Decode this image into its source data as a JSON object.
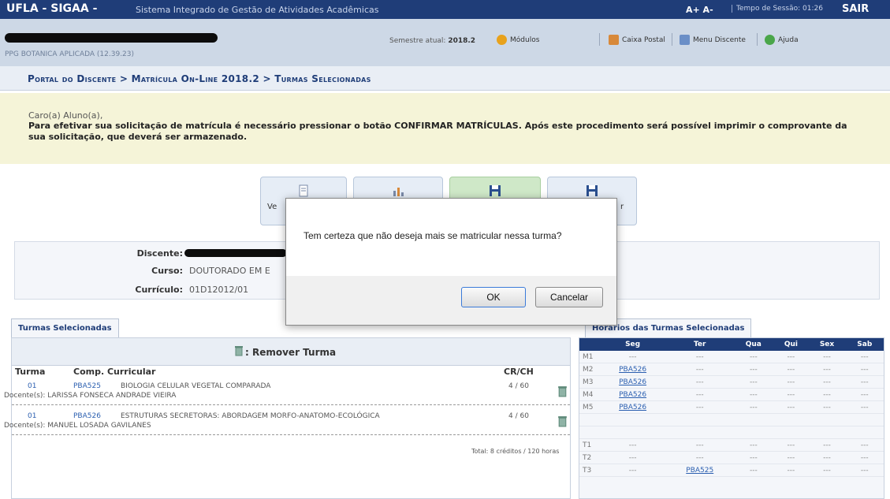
{
  "topbar": {
    "brand": "UFLA - SIGAA -",
    "system": "Sistema Integrado de Gestão de Atividades Acadêmicas",
    "font_controls": "A+ A-",
    "session": "Tempo de Sessão: 01:26",
    "exit": "SAIR"
  },
  "subbar": {
    "unit": "PPG BOTANICA APLICADA (12.39.23)",
    "semester_label": "Semestre atual:",
    "semester_value": "2018.2",
    "links": [
      "Módulos",
      "Caixa Postal",
      "Menu Discente",
      "Ajuda"
    ]
  },
  "page": {
    "title": "Portal do Discente > Matrícula On-Line 2018.2 > Turmas Selecionadas"
  },
  "message": {
    "greeting": "Caro(a) Aluno(a),",
    "text": "Para efetivar sua solicitação de matrícula é necessário pressionar o botão CONFIRMAR MATRÍCULAS. Após este procedimento será possível imprimir o comprovante da sua solicitação, que deverá ser armazenado."
  },
  "actions": {
    "btn1": "Ve",
    "btn4": "r"
  },
  "info": {
    "discente_label": "Discente:",
    "curso_label": "Curso:",
    "curso_value": "DOUTORADO EM E",
    "curriculo_label": "Currículo:",
    "curriculo_value": "01D12012/01"
  },
  "tabs": {
    "left": "Turmas Selecionadas",
    "right": "Horários das Turmas Selecionadas"
  },
  "turmas": {
    "remove_label": ": Remover Turma",
    "headers": {
      "turma": "Turma",
      "comp": "Comp. Curricular",
      "crch": "CR/CH"
    },
    "rows": [
      {
        "turma": "01",
        "code": "PBA525",
        "name": "BIOLOGIA CELULAR VEGETAL COMPARADA",
        "docente": "Docente(s): LARISSA FONSECA ANDRADE VIEIRA",
        "crch": "4 / 60"
      },
      {
        "turma": "01",
        "code": "PBA526",
        "name": "ESTRUTURAS SECRETORAS: ABORDAGEM MORFO-ANATOMO-ECOLÓGICA",
        "docente": "Docente(s): MANUEL LOSADA GAVILANES",
        "crch": "4 / 60"
      }
    ],
    "total": "Total: 8 créditos / 120 horas"
  },
  "schedule": {
    "days": [
      "Seg",
      "Ter",
      "Qua",
      "Qui",
      "Sex",
      "Sab"
    ],
    "rows": [
      {
        "slot": "M1",
        "cells": [
          "---",
          "---",
          "---",
          "---",
          "---",
          "---"
        ]
      },
      {
        "slot": "M2",
        "cells": [
          "PBA526",
          "---",
          "---",
          "---",
          "---",
          "---"
        ]
      },
      {
        "slot": "M3",
        "cells": [
          "PBA526",
          "---",
          "---",
          "---",
          "---",
          "---"
        ]
      },
      {
        "slot": "M4",
        "cells": [
          "PBA526",
          "---",
          "---",
          "---",
          "---",
          "---"
        ]
      },
      {
        "slot": "M5",
        "cells": [
          "PBA526",
          "---",
          "---",
          "---",
          "---",
          "---"
        ]
      },
      {
        "slot": "",
        "cells": [
          "",
          "",
          "",
          "",
          "",
          ""
        ]
      },
      {
        "slot": "",
        "cells": [
          "",
          "",
          "",
          "",
          "",
          ""
        ]
      },
      {
        "slot": "T1",
        "cells": [
          "---",
          "---",
          "---",
          "---",
          "---",
          "---"
        ]
      },
      {
        "slot": "T2",
        "cells": [
          "---",
          "---",
          "---",
          "---",
          "---",
          "---"
        ]
      },
      {
        "slot": "T3",
        "cells": [
          "---",
          "PBA525",
          "---",
          "---",
          "---",
          "---"
        ]
      }
    ]
  },
  "dialog": {
    "question": "Tem certeza que não deseja mais se matricular nessa turma?",
    "ok": "OK",
    "cancel": "Cancelar"
  },
  "colors": {
    "topbar": "#1f3d78",
    "subbar": "#cdd8e6",
    "message_bg": "#f5f4d8",
    "link": "#2b5fb0"
  }
}
